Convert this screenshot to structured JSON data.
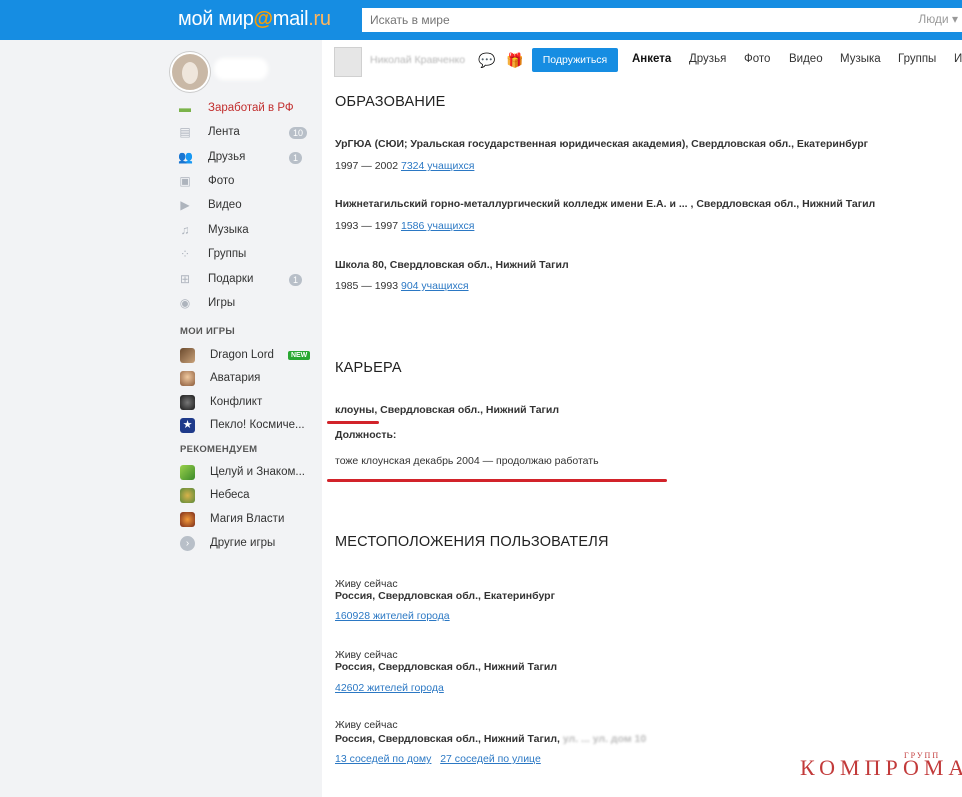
{
  "header": {
    "logo_main": "мой мир",
    "logo_at": "@",
    "logo_mail": "mail",
    "logo_ru": ".ru",
    "search_placeholder": "Искать в мире",
    "search_scope": "Люди"
  },
  "sidebar": {
    "menu": [
      {
        "label": "Заработай в РФ",
        "icon": "money-icon"
      },
      {
        "label": "Лента",
        "icon": "feed-icon",
        "badge": "10"
      },
      {
        "label": "Друзья",
        "icon": "friends-icon",
        "badge": "1"
      },
      {
        "label": "Фото",
        "icon": "photo-icon"
      },
      {
        "label": "Видео",
        "icon": "video-icon"
      },
      {
        "label": "Музыка",
        "icon": "music-icon"
      },
      {
        "label": "Группы",
        "icon": "groups-icon"
      },
      {
        "label": "Подарки",
        "icon": "gift-icon",
        "badge": "1"
      },
      {
        "label": "Игры",
        "icon": "gamepad-icon"
      }
    ],
    "my_games_title": "МОИ ИГРЫ",
    "my_games": [
      {
        "label": "Dragon Lord",
        "badge": "NEW"
      },
      {
        "label": "Аватария"
      },
      {
        "label": "Конфликт"
      },
      {
        "label": "Пекло! Космиче..."
      }
    ],
    "recommend_title": "РЕКОМЕНДУЕМ",
    "recommend": [
      {
        "label": "Целуй и Знаком..."
      },
      {
        "label": "Небеса"
      },
      {
        "label": "Магия Власти"
      },
      {
        "label": "Другие игры"
      }
    ]
  },
  "profile_bar": {
    "name": "Николай Кравченко",
    "add_friend_label": "Подружиться",
    "tabs": [
      "Анкета",
      "Друзья",
      "Фото",
      "Видео",
      "Музыка",
      "Группы",
      "И"
    ]
  },
  "education": {
    "title": "ОБРАЗОВАНИЕ",
    "items": [
      {
        "name": "УрГЮА (СЮИ; Уральская государственная юридическая академия), Свердловская обл., Екатеринбург",
        "years": "1997 — 2002",
        "link": "7324 учащихся"
      },
      {
        "name": "Нижнетагильский горно-металлургический колледж имени Е.А. и ... , Свердловская обл., Нижний Тагил",
        "years": "1993 — 1997",
        "link": "1586 учащихся"
      },
      {
        "name": "Школа 80, Свердловская обл., Нижний Тагил",
        "years": "1985 — 1993",
        "link": "904 учащихся"
      }
    ]
  },
  "career": {
    "title": "КАРЬЕРА",
    "place": "клоуны, Свердловская обл., Нижний Тагил",
    "position_label": "Должность:",
    "position_value": "тоже клоунская декабрь 2004 — продолжаю работать"
  },
  "locations": {
    "title": "МЕСТОПОЛОЖЕНИЯ ПОЛЬЗОВАТЕЛЯ",
    "items": [
      {
        "status": "Живу сейчас",
        "place": "Россия, Свердловская обл., Екатеринбург",
        "links": [
          "160928 жителей города"
        ]
      },
      {
        "status": "Живу сейчас",
        "place": "Россия, Свердловская обл., Нижний Тагил",
        "links": [
          "42602 жителей города"
        ]
      },
      {
        "status": "Живу сейчас",
        "place": "Россия, Свердловская обл., Нижний Тагил,",
        "place_blur": "ул. ... ул. дом 10",
        "links": [
          "13 соседей по дому",
          "27 соседей по улице"
        ]
      }
    ]
  },
  "watermark": {
    "main": "КОМПРОМАТ",
    "top": "ГРУПП"
  },
  "colors": {
    "brand_blue": "#168de2",
    "accent_red": "#d2232a",
    "link": "#2b78c4"
  }
}
